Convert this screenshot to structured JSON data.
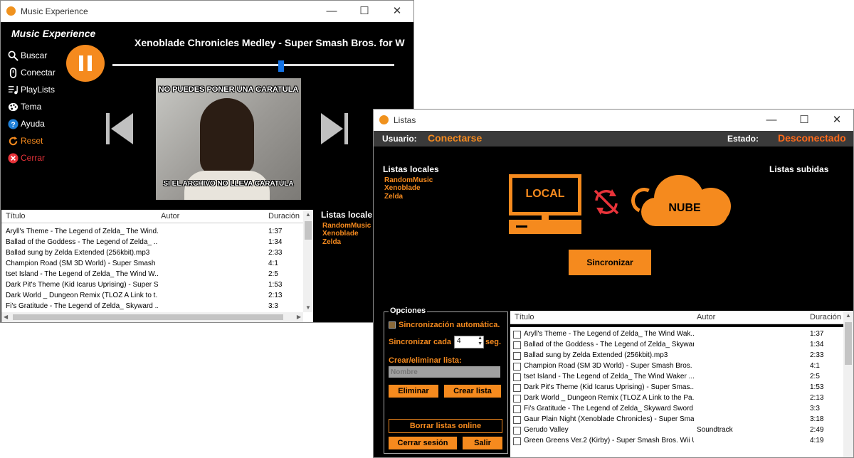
{
  "main_window": {
    "title": "Music Experience",
    "app_name": "Music Experience",
    "now_playing": "Xenoblade Chronicles Medley - Super Smash Bros. for W",
    "progress": 0.6,
    "cover_text_top": "NO PUEDES PONER UNA   CARATULA",
    "cover_text_bottom": "SI EL ARCHIVO NO LLEVA CARATULA",
    "menu": [
      {
        "label": "Buscar",
        "icon": "search-icon"
      },
      {
        "label": "Conectar",
        "icon": "connect-icon"
      },
      {
        "label": "PlayLists",
        "icon": "playlist-icon"
      },
      {
        "label": "Tema",
        "icon": "palette-icon"
      },
      {
        "label": "Ayuda",
        "icon": "help-icon"
      },
      {
        "label": "Reset",
        "icon": "reset-icon"
      },
      {
        "label": "Cerrar",
        "icon": "close-circle-icon"
      }
    ],
    "columns": [
      "Título",
      "Autor",
      "Duración"
    ],
    "rows": [
      {
        "title": "Aryll's Theme - The Legend of Zelda_ The Wind...",
        "author": "",
        "duration": "1:37"
      },
      {
        "title": "Ballad of the Goddess - The Legend of Zelda_ ...",
        "author": "",
        "duration": "1:34"
      },
      {
        "title": "Ballad sung by Zelda Extended (256kbit).mp3",
        "author": "",
        "duration": "2:33"
      },
      {
        "title": "Champion Road (SM 3D World) - Super Smash ...",
        "author": "",
        "duration": "4:1"
      },
      {
        "title": "tset Island - The Legend of Zelda_ The Wind W...",
        "author": "",
        "duration": "2:5"
      },
      {
        "title": "Dark Pit's Theme (Kid Icarus Uprising) - Super S...",
        "author": "",
        "duration": "1:53"
      },
      {
        "title": "Dark World _ Dungeon Remix (TLOZ A Link to t...",
        "author": "",
        "duration": "2:13"
      },
      {
        "title": "Fi's Gratitude - The Legend of Zelda_ Skyward ...",
        "author": "",
        "duration": "3:3"
      }
    ],
    "local_lists_title": "Listas locale",
    "local_lists": [
      "RandomMusic",
      "Xenoblade",
      "Zelda"
    ]
  },
  "lists_window": {
    "title": "Listas",
    "user_label": "Usuario:",
    "user_value": "Conectarse",
    "status_label": "Estado:",
    "status_value": "Desconectado",
    "local_lists_title": "Listas locales",
    "local_lists": [
      "RandomMusic",
      "Xenoblade",
      "Zelda"
    ],
    "uploaded_lists_title": "Listas subidas",
    "local_label": "LOCAL",
    "cloud_label": "NUBE",
    "sync_button": "Sincronizar",
    "options": {
      "title": "Opciones",
      "auto_sync": "Sincronización automática.",
      "sync_every": "Sincronizar cada",
      "sync_value": "4",
      "sync_unit": "seg.",
      "create_delete": "Crear/eliminar lista:",
      "name_placeholder": "Nombre",
      "delete_button": "Eliminar",
      "create_button": "Crear lista",
      "delete_online_button": "Borrar listas online",
      "logout_button": "Cerrar sesión",
      "exit_button": "Salir"
    },
    "columns": [
      "Título",
      "Autor",
      "Duración"
    ],
    "rows": [
      {
        "title": "Aryll's Theme - The Legend of Zelda_ The Wind Wak...",
        "author": "",
        "duration": "1:37"
      },
      {
        "title": "Ballad of the Goddess - The Legend of Zelda_ Skywar...",
        "author": "",
        "duration": "1:34"
      },
      {
        "title": "Ballad sung by Zelda Extended (256kbit).mp3",
        "author": "",
        "duration": "2:33"
      },
      {
        "title": "Champion Road (SM 3D World) - Super Smash Bros. ...",
        "author": "",
        "duration": "4:1"
      },
      {
        "title": "tset Island - The Legend of Zelda_ The Wind Waker ...",
        "author": "",
        "duration": "2:5"
      },
      {
        "title": "Dark Pit's Theme (Kid Icarus Uprising) - Super Smas...",
        "author": "",
        "duration": "1:53"
      },
      {
        "title": "Dark World _ Dungeon Remix (TLOZ A Link to the Pa...",
        "author": "",
        "duration": "2:13"
      },
      {
        "title": "Fi's Gratitude - The Legend of Zelda_ Skyward Sword ...",
        "author": "",
        "duration": "3:3"
      },
      {
        "title": "Gaur Plain Night (Xenoblade Chronicles) - Super Smas...",
        "author": "",
        "duration": "3:18"
      },
      {
        "title": "Gerudo Valley",
        "author": "Soundtrack",
        "duration": "2:49"
      },
      {
        "title": "Green Greens Ver.2 (Kirby) - Super Smash Bros. Wii U ...",
        "author": "",
        "duration": "4:19"
      }
    ]
  },
  "colors": {
    "accent": "#f58a1e",
    "background": "#000000",
    "header_bar": "#3a3a3a"
  }
}
